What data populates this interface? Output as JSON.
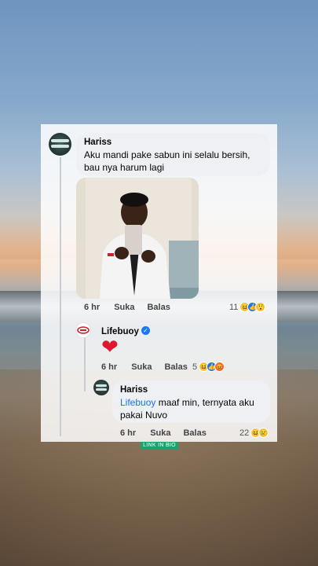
{
  "comments": {
    "main": {
      "author": "Hariss",
      "text": "Aku mandi pake sabun ini selalu bersih, bau nya harum lagi",
      "time": "6 hr",
      "like_label": "Suka",
      "reply_label": "Balas",
      "reaction_count": "11",
      "reactions": [
        "haha",
        "like",
        "wow"
      ]
    },
    "reply1": {
      "author": "Lifebuoy",
      "verified": true,
      "text": "❤",
      "time": "6 hr",
      "like_label": "Suka",
      "reply_label": "Balas",
      "reaction_count": "5",
      "reactions": [
        "haha",
        "like",
        "angry"
      ]
    },
    "reply2": {
      "author": "Hariss",
      "mention": "Lifebuoy",
      "text": " maaf min, ternyata aku pakai Nuvo",
      "time": "6 hr",
      "like_label": "Suka",
      "reply_label": "Balas",
      "reaction_count": "22",
      "reactions": [
        "haha",
        "sad"
      ]
    }
  },
  "overlay": {
    "link_bio": "LINK IN BIO"
  },
  "colors": {
    "mention": "#1b74e4",
    "verified": "#1877f2",
    "heart": "#e0182d"
  }
}
